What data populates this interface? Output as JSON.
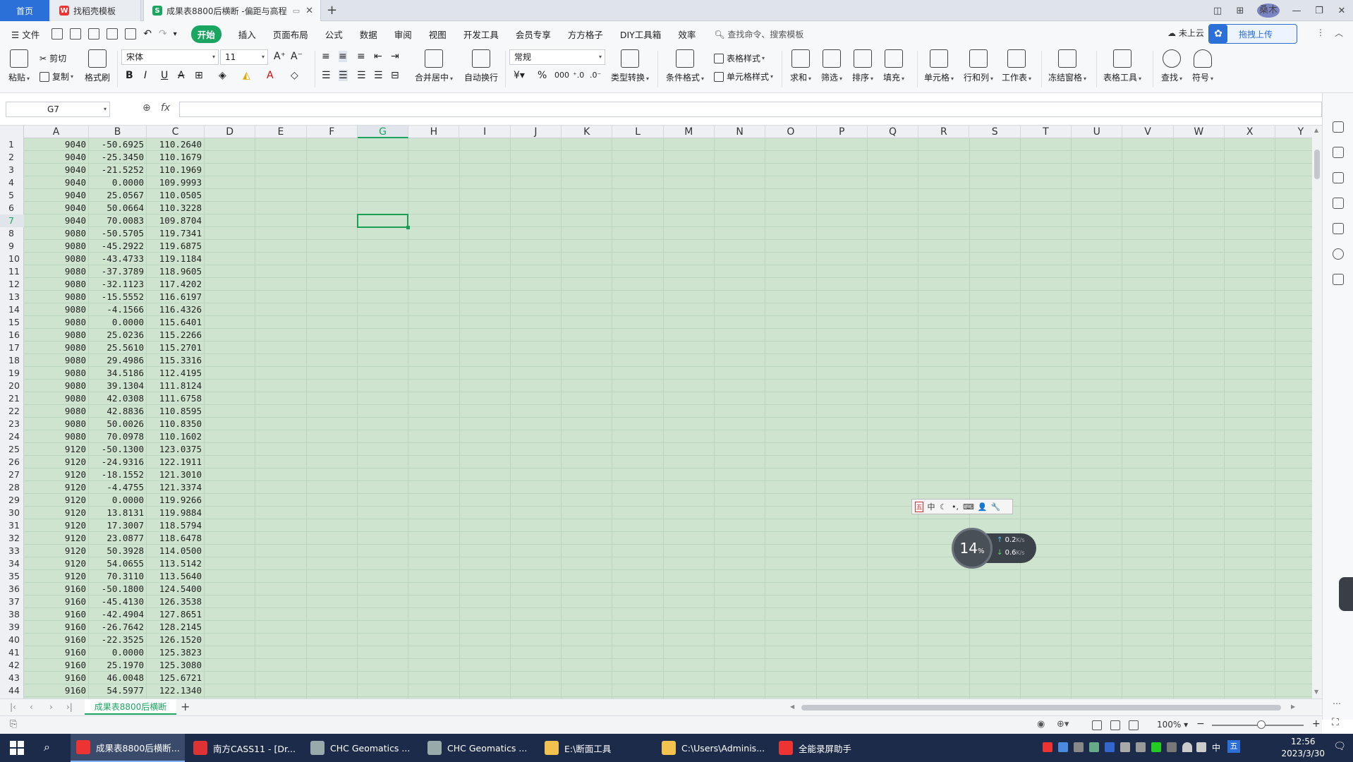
{
  "tabs": {
    "home": "首页",
    "template": "找稻壳模板",
    "active_doc": "成果表8800后横断 -偏距与高程"
  },
  "avatar_label": "桑木",
  "menu": {
    "file": "文件",
    "items": [
      "开始",
      "插入",
      "页面布局",
      "公式",
      "数据",
      "审阅",
      "视图",
      "开发工具",
      "会员专享",
      "方方格子",
      "DIY工具箱",
      "效率"
    ],
    "search_placeholder": "查找命令、搜索模板",
    "cloud_status": "未上云",
    "upload_label": "拖拽上传"
  },
  "ribbon": {
    "paste": "粘贴",
    "cut": "剪切",
    "copy": "复制",
    "format_painter": "格式刷",
    "font_name": "宋体",
    "font_size": "11",
    "merge_center": "合并居中",
    "wrap_text": "自动换行",
    "number_format": "常规",
    "type_convert": "类型转换",
    "cond_format": "条件格式",
    "table_style": "表格样式",
    "cell_style": "单元格样式",
    "sum": "求和",
    "filter": "筛选",
    "sort": "排序",
    "fill": "填充",
    "cell": "单元格",
    "row_col": "行和列",
    "worksheet": "工作表",
    "freeze": "冻结窗格",
    "table_tools": "表格工具",
    "find": "查找",
    "symbol": "符号"
  },
  "formula_bar": {
    "name_box": "G7",
    "fx": "fx",
    "value": ""
  },
  "columns": [
    "A",
    "B",
    "C",
    "D",
    "E",
    "F",
    "G",
    "H",
    "I",
    "J",
    "K",
    "L",
    "M",
    "N",
    "O",
    "P",
    "Q",
    "R",
    "S",
    "T",
    "U",
    "V",
    "W",
    "X",
    "Y"
  ],
  "selected_cell": {
    "col": "G",
    "row": 7
  },
  "rows": [
    [
      "9040",
      "-50.6925",
      "110.2640"
    ],
    [
      "9040",
      "-25.3450",
      "110.1679"
    ],
    [
      "9040",
      "-21.5252",
      "110.1969"
    ],
    [
      "9040",
      "0.0000",
      "109.9993"
    ],
    [
      "9040",
      "25.0567",
      "110.0505"
    ],
    [
      "9040",
      "50.0664",
      "110.3228"
    ],
    [
      "9040",
      "70.0083",
      "109.8704"
    ],
    [
      "9080",
      "-50.5705",
      "119.7341"
    ],
    [
      "9080",
      "-45.2922",
      "119.6875"
    ],
    [
      "9080",
      "-43.4733",
      "119.1184"
    ],
    [
      "9080",
      "-37.3789",
      "118.9605"
    ],
    [
      "9080",
      "-32.1123",
      "117.4202"
    ],
    [
      "9080",
      "-15.5552",
      "116.6197"
    ],
    [
      "9080",
      "-4.1566",
      "116.4326"
    ],
    [
      "9080",
      "0.0000",
      "115.6401"
    ],
    [
      "9080",
      "25.0236",
      "115.2266"
    ],
    [
      "9080",
      "25.5610",
      "115.2701"
    ],
    [
      "9080",
      "29.4986",
      "115.3316"
    ],
    [
      "9080",
      "34.5186",
      "112.4195"
    ],
    [
      "9080",
      "39.1304",
      "111.8124"
    ],
    [
      "9080",
      "42.0308",
      "111.6758"
    ],
    [
      "9080",
      "42.8836",
      "110.8595"
    ],
    [
      "9080",
      "50.0026",
      "110.8350"
    ],
    [
      "9080",
      "70.0978",
      "110.1602"
    ],
    [
      "9120",
      "-50.1300",
      "123.0375"
    ],
    [
      "9120",
      "-24.9316",
      "122.1911"
    ],
    [
      "9120",
      "-18.1552",
      "121.3010"
    ],
    [
      "9120",
      "-4.4755",
      "121.3374"
    ],
    [
      "9120",
      "0.0000",
      "119.9266"
    ],
    [
      "9120",
      "13.8131",
      "119.9884"
    ],
    [
      "9120",
      "17.3007",
      "118.5794"
    ],
    [
      "9120",
      "23.0877",
      "118.6478"
    ],
    [
      "9120",
      "50.3928",
      "114.0500"
    ],
    [
      "9120",
      "54.0655",
      "113.5142"
    ],
    [
      "9120",
      "70.3110",
      "113.5640"
    ],
    [
      "9160",
      "-50.1800",
      "124.5400"
    ],
    [
      "9160",
      "-45.4130",
      "126.3538"
    ],
    [
      "9160",
      "-42.4904",
      "127.8651"
    ],
    [
      "9160",
      "-26.7642",
      "128.2145"
    ],
    [
      "9160",
      "-22.3525",
      "126.1520"
    ],
    [
      "9160",
      "0.0000",
      "125.3823"
    ],
    [
      "9160",
      "25.1970",
      "125.3080"
    ],
    [
      "9160",
      "46.0048",
      "125.6721"
    ],
    [
      "9160",
      "54.5977",
      "122.1340"
    ]
  ],
  "ime_bar": [
    "中",
    "☾",
    "•,",
    "⌨",
    "👤",
    "🔧"
  ],
  "net_widget": {
    "percent": "14",
    "unit": "%",
    "up": "0.2",
    "down": "0.6",
    "rate_unit": "K/s"
  },
  "sheet_tab": "成果表8800后横断",
  "status": {
    "zoom": "100%"
  },
  "taskbar": {
    "items": [
      {
        "label": "成果表8800后横断...",
        "color": "#e33"
      },
      {
        "label": "南方CASS11 - [Dr...",
        "color": "#d33"
      },
      {
        "label": "CHC Geomatics ...",
        "color": "#9aa"
      },
      {
        "label": "CHC Geomatics ...",
        "color": "#9aa"
      },
      {
        "label": "E:\\断面工具",
        "color": "#f2c14e"
      },
      {
        "label": "C:\\Users\\Adminis...",
        "color": "#f2c14e"
      },
      {
        "label": "全能录屏助手",
        "color": "#e33"
      }
    ],
    "time": "12:56",
    "date": "2023/3/30",
    "ime_zh": "中",
    "ime_mode": "五"
  }
}
